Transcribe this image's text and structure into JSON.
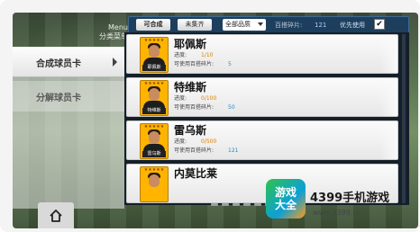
{
  "menu": {
    "title_en": "Menu",
    "title_cn": "分类菜单",
    "items": [
      {
        "label": "合成球员卡",
        "active": true
      },
      {
        "label": "分解球员卡",
        "active": false
      }
    ]
  },
  "filter_bar": {
    "compose_label": "可合成",
    "uncollected_label": "未集齐",
    "quality_select": "全部品质",
    "fragments_label": "百搭碎片:",
    "fragments_value": "121",
    "priority_label": "优先使用",
    "priority_checked": "✔"
  },
  "cards": [
    {
      "name": "耶佩斯",
      "plate": "耶佩斯",
      "stars": "★★★★★",
      "progress_label": "进度:",
      "progress": "1/10",
      "usable_label": "可使用百搭碎片:",
      "usable": "5"
    },
    {
      "name": "特维斯",
      "plate": "特维斯",
      "stars": "★★★★★",
      "progress_label": "进度:",
      "progress": "0/100",
      "usable_label": "可使用百搭碎片:",
      "usable": "50"
    },
    {
      "name": "雷乌斯",
      "plate": "雷乌斯",
      "stars": "★★★★★",
      "progress_label": "进度:",
      "progress": "0/500",
      "usable_label": "可使用百搭碎片:",
      "usable": "121"
    },
    {
      "name": "内莫比莱",
      "plate": "",
      "stars": "★★★★★",
      "progress_label": "",
      "progress": "",
      "usable_label": "",
      "usable": ""
    }
  ],
  "watermark": {
    "logo_line1": "游戏",
    "logo_line2": "大全",
    "text": "4399手机游戏",
    "url": "www.4399.cn"
  },
  "icons": {
    "home": "home-icon",
    "menu_arrow": "chevron-right-icon",
    "quality_chevron": "chevron-down-icon",
    "checkbox": "checkbox-checked-icon"
  },
  "colors": {
    "accent_orange": "#d98000",
    "accent_blue": "#2a8ac8",
    "card_gold": "#ffb400",
    "bar_navy": "#1e3e5e"
  }
}
